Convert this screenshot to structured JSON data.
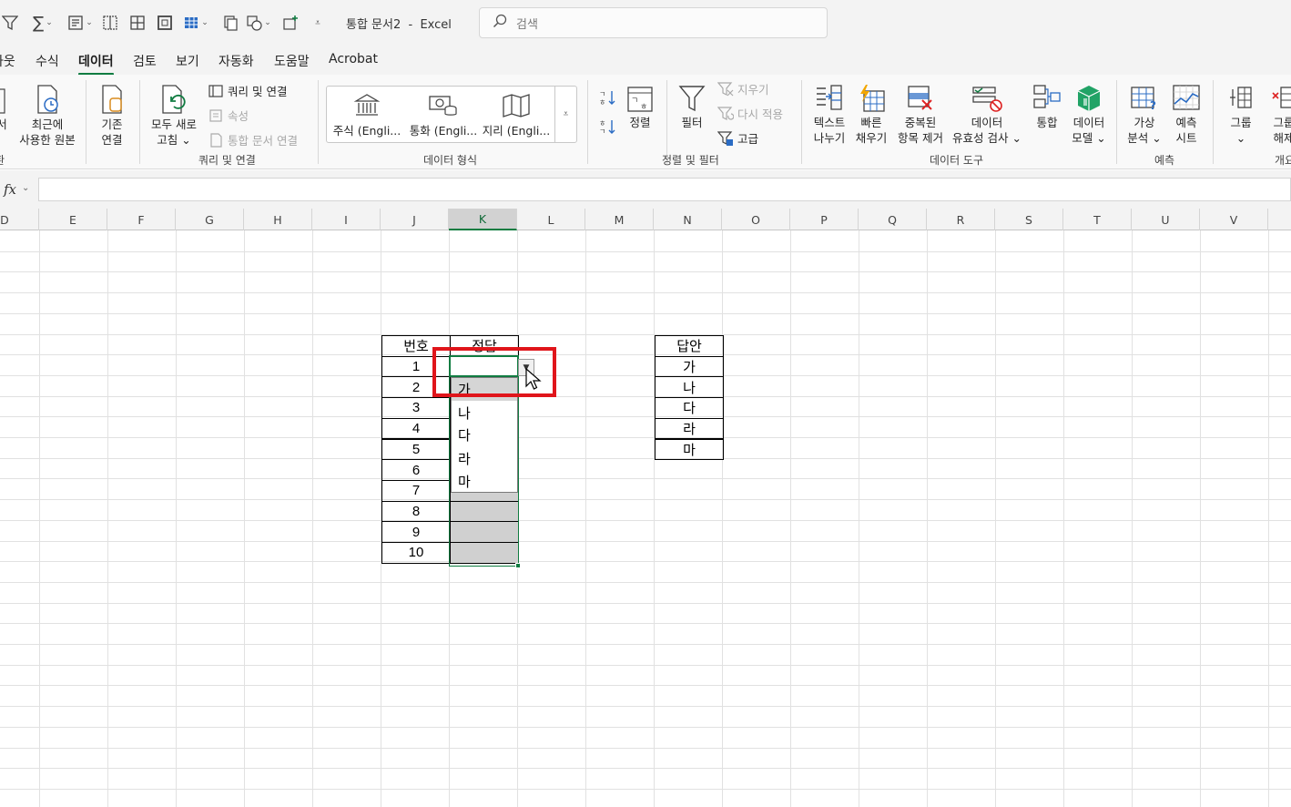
{
  "app": {
    "doc_title": "통합 문서2  -  Excel",
    "search_placeholder": "검색"
  },
  "tabs": [
    {
      "label": "파웃",
      "active": false
    },
    {
      "label": "수식",
      "active": false
    },
    {
      "label": "데이터",
      "active": true
    },
    {
      "label": "검토",
      "active": false
    },
    {
      "label": "보기",
      "active": false
    },
    {
      "label": "자동화",
      "active": false
    },
    {
      "label": "도움말",
      "active": false
    },
    {
      "label": "Acrobat",
      "active": false
    }
  ],
  "ribbon": {
    "get_data_partial": "서",
    "recent_sources": "최근에\n사용한 원본",
    "existing_connections": "기존\n연결",
    "refresh_all": "모두 새로\n고침 ⌄",
    "queries_connections": "쿼리 및 연결",
    "properties": "속성",
    "edit_links": "통합 문서 연결",
    "group_get_partial": "환",
    "group_queries": "쿼리 및 연결",
    "datatype_stocks": "주식 (Engli...",
    "datatype_currency": "통화 (Engli...",
    "datatype_geography": "지리 (Engli...",
    "group_datatypes": "데이터 형식",
    "sort": "정렬",
    "filter": "필터",
    "clear": "지우기",
    "reapply": "다시 적용",
    "advanced": "고급",
    "group_sort_filter": "정렬 및 필터",
    "text_to_columns": "텍스트\n나누기",
    "flash_fill": "빠른\n채우기",
    "remove_duplicates": "중복된\n항목 제거",
    "data_validation": "데이터\n유효성 검사 ⌄",
    "consolidate": "통합",
    "data_model": "데이터\n모델 ⌄",
    "group_data_tools": "데이터 도구",
    "what_if": "가상\n분석 ⌄",
    "forecast_sheet": "예측\n시트",
    "group_forecast": "예측",
    "group_btn": "그룹\n⌄",
    "ungroup_btn": "그룹\n해제",
    "group_outline_partial": "개요"
  },
  "formula_bar": {
    "fx": "fx",
    "value": ""
  },
  "columns": [
    "D",
    "E",
    "F",
    "G",
    "H",
    "I",
    "J",
    "K",
    "L",
    "M",
    "N",
    "O",
    "P",
    "Q",
    "R",
    "S",
    "T",
    "U",
    "V"
  ],
  "active_column": "K",
  "table1": {
    "header_number": "번호",
    "header_answer": "정답",
    "numbers": [
      "1",
      "2",
      "3",
      "4",
      "5",
      "6",
      "7",
      "8",
      "9",
      "10"
    ]
  },
  "table2": {
    "header": "답안",
    "values": [
      "가",
      "나",
      "다",
      "라",
      "마"
    ]
  },
  "dropdown": {
    "options": [
      "가",
      "나",
      "다",
      "라",
      "마"
    ],
    "highlighted_index": 0
  }
}
